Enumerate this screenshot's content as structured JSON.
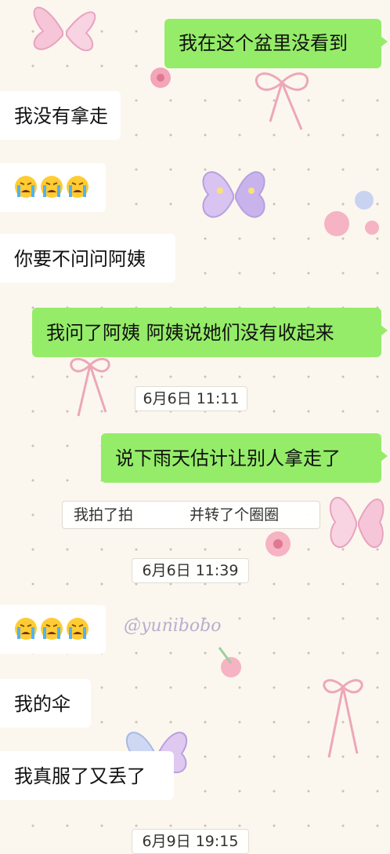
{
  "messages": [
    {
      "side": "out",
      "text": "我在这个盆里没看到"
    },
    {
      "side": "in",
      "text": "我没有拿走"
    },
    {
      "side": "in",
      "emoji": "loudly-crying-face",
      "count": 3
    },
    {
      "side": "in",
      "text": "你要不问问阿姨"
    },
    {
      "side": "out",
      "text": "我问了阿姨 阿姨说她们没有收起来"
    },
    {
      "side": "time",
      "text": "6月6日 11:11"
    },
    {
      "side": "out",
      "text": "说下雨天估计让别人拿走了"
    },
    {
      "side": "system",
      "before": "我拍了拍",
      "after": "并转了个圈圈"
    },
    {
      "side": "time",
      "text": "6月6日 11:39"
    },
    {
      "side": "in",
      "emoji": "loudly-crying-face",
      "count": 3
    },
    {
      "side": "in",
      "text": "我的伞"
    },
    {
      "side": "in",
      "text": "我真服了又丢了"
    },
    {
      "side": "time",
      "text": "6月9日 19:15"
    }
  ],
  "watermark": "@yunibobo",
  "colors": {
    "outgoing": "#95ec69",
    "incoming": "#ffffff",
    "background": "#fbf7ee"
  }
}
